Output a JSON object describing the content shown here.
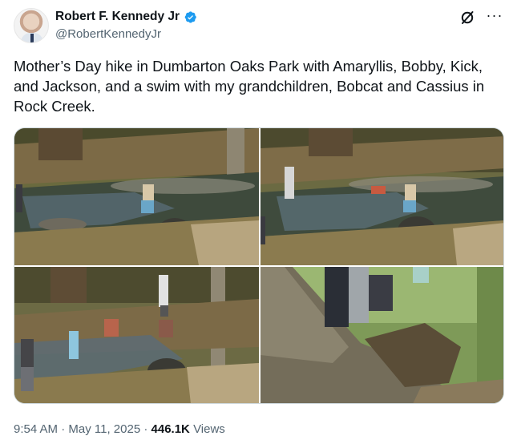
{
  "author": {
    "display_name": "Robert F. Kennedy Jr",
    "handle": "@RobertKennedyJr",
    "verified": true,
    "avatar_icon": "profile-photo"
  },
  "header_icons": [
    "grok-icon",
    "more-icon"
  ],
  "post": {
    "text": "Mother’s Day hike in Dumbarton Oaks Park with Amaryllis, Bobby, Kick, and Jackson, and a swim with my grandchildren, Bobcat and Cassius in Rock Creek."
  },
  "media": {
    "photos": [
      {
        "name": "creek-photo-1"
      },
      {
        "name": "creek-photo-2"
      },
      {
        "name": "creek-photo-3"
      },
      {
        "name": "fallen-tree-photo"
      }
    ]
  },
  "meta": {
    "time": "9:54 AM",
    "separator": " · ",
    "date": "May 11, 2025",
    "views_count": "446.1K",
    "views_label": "Views"
  },
  "colors": {
    "text": "#0f1419",
    "secondary": "#536471",
    "verified": "#1d9bf0",
    "border": "#cfd9de"
  }
}
